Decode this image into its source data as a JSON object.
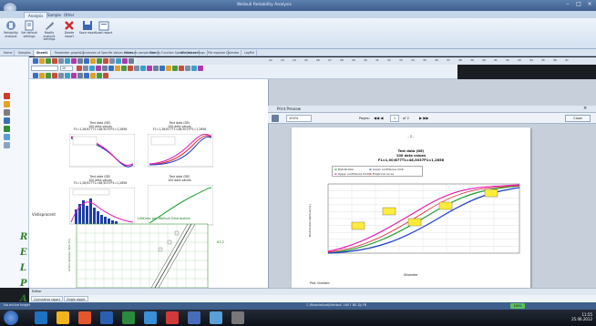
{
  "ribbon": {
    "tabs": [
      {
        "label": "Analysis"
      },
      {
        "label": "Sample"
      },
      {
        "label": "Other"
      }
    ],
    "buttons": [
      {
        "label": "Reliability analysis"
      },
      {
        "label": "Set default settings"
      },
      {
        "label": "Modify analysis settings"
      },
      {
        "label": "Delete report"
      },
      {
        "label": "Save report"
      },
      {
        "label": "Load report"
      }
    ]
  },
  "sheet_tabs": [
    "Home",
    "Samples",
    "Sheet1",
    "Parameter graphs",
    "Conversion of Specific Values values",
    "Minimum sample size",
    "Density Function Specific Values",
    "Analysis settings",
    "File explorer",
    "Calendar",
    "LogFile"
  ],
  "toolbar": {
    "font_size": "10",
    "zoom": "100%"
  },
  "column_numbers": [
    "22",
    "23",
    "24",
    "25",
    "26",
    "27",
    "28",
    "29",
    "30",
    "31",
    "32",
    "33",
    "34",
    "35",
    "36",
    "37",
    "38",
    "39",
    "40",
    "41",
    "42",
    "43",
    "44",
    "45",
    "46",
    "47"
  ],
  "sheet": {
    "left_letters": [
      "R",
      "E",
      "L",
      "P",
      "A",
      "D"
    ],
    "small_charts": [
      {
        "title": "Test data (DE)",
        "subtitle": "100 data values",
        "params": "F1=1,28;B77T1=48;5037P1=1,2856"
      },
      {
        "title": "Test data (DE)",
        "subtitle": "100 data values",
        "params": "F1=1,28;B77T1=48;5037P1=1,2856"
      },
      {
        "title": "Test data (DE)",
        "subtitle": "100 data values",
        "params": "F1=1,28;B77T1=48;5037P1=1,2856"
      },
      {
        "title": "Test data (DE)",
        "subtitle": "100 data values",
        "params": ""
      }
    ],
    "legend_line1": [
      "Distribution",
      "Lower confidence limit",
      "Upper confidence limit",
      "Empirical curve"
    ],
    "legend_hist": [
      "Empirical curve",
      "Density"
    ],
    "vistisprocent_label": "Vistisprocent",
    "weibull_title": "Lifetime per Weibull Distribution",
    "weibull_xaxis": "Einheitsprozent",
    "weibull_yaxis": "Anteil defekter Teile [%]",
    "weibull_badge": "63.2"
  },
  "print_preview": {
    "title": "Print Preview",
    "zoom": "100%",
    "pages_label": "Pages:",
    "of_label": "of 2",
    "page_input": "1",
    "close_label": "Close",
    "page_number": "- 2 -",
    "chart_title": "Test data (DE)",
    "chart_subtitle": "100 data values",
    "chart_params": "F1=1,00;B77T1=48,5037P1=1,2856",
    "legend": [
      "Distribution",
      "Lower confidence limit",
      "Upper confidence limit",
      "Empirical curve"
    ],
    "y_label": "Distribution-Weibull [%]",
    "x_label": "Kilometer",
    "footer": "Prot. Number:"
  },
  "bottom": {
    "editor_label": "Editor",
    "tabs": [
      "Cumulative report",
      "Single report"
    ]
  },
  "statusbar": {
    "left": "No active target",
    "center": "C:\\Rejsdat\\adj\\Weibull 1607 BE-DJ-FB"
  },
  "taskbar": {
    "time": "11:55",
    "date": "25.06.2012",
    "zoom": "100%"
  },
  "colors": {
    "accent": "#3f5f8d",
    "chart_red": "#d8232a",
    "chart_blue": "#1f3fc8",
    "chart_magenta": "#e01bb3",
    "chart_green": "#18a02a",
    "letter_green": "#2f7d2f"
  }
}
